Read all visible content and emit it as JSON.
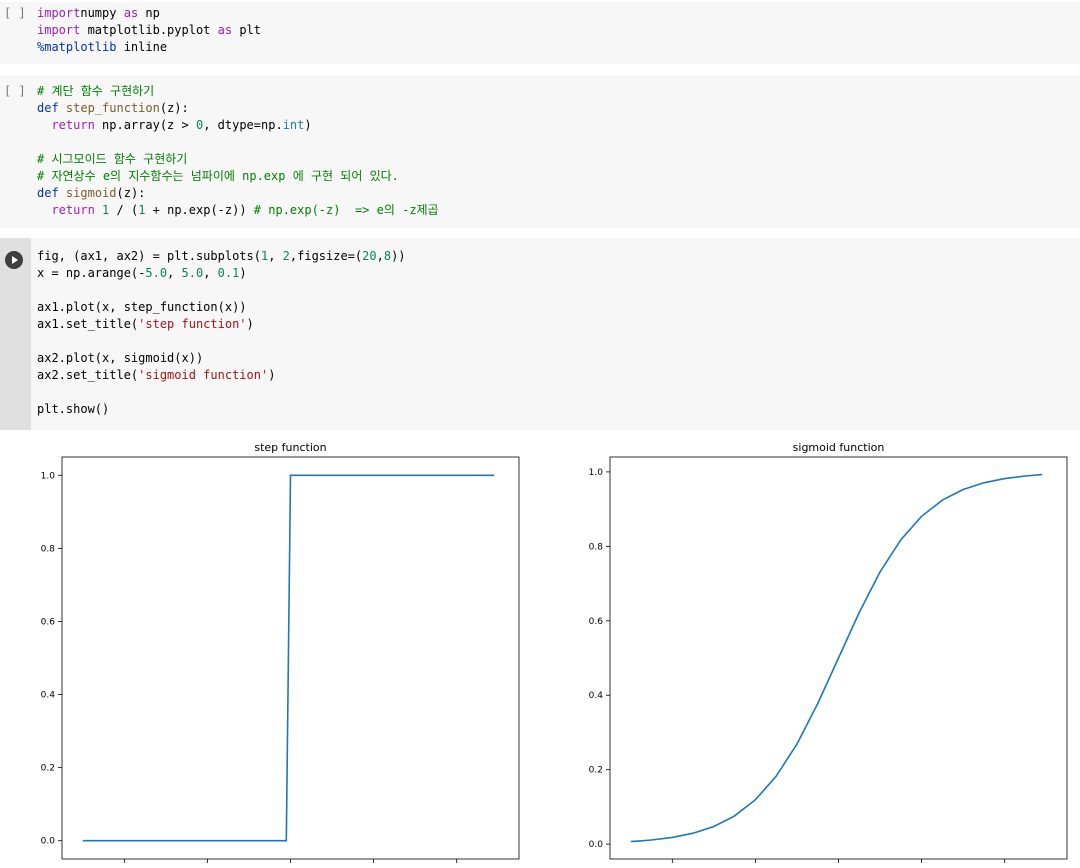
{
  "cells": [
    {
      "exec_count": "[ ]",
      "lines": [
        [
          [
            "kw",
            "import"
          ],
          [
            "",
            "numpy "
          ],
          [
            "kw",
            "as"
          ],
          [
            "",
            " np"
          ]
        ],
        [
          [
            "kw",
            "import"
          ],
          [
            "",
            " matplotlib.pyplot "
          ],
          [
            "kw",
            "as"
          ],
          [
            "",
            " plt"
          ]
        ],
        [
          [
            "mg",
            "%matplotlib"
          ],
          [
            "",
            " inline"
          ]
        ]
      ]
    },
    {
      "exec_count": "[ ]",
      "lines": [
        [
          [
            "cm",
            "# 계단 함수 구현하기"
          ]
        ],
        [
          [
            "kw2",
            "def"
          ],
          [
            "",
            " "
          ],
          [
            "fn",
            "step_function"
          ],
          [
            "",
            "(z):"
          ]
        ],
        [
          [
            "",
            "  "
          ],
          [
            "kw",
            "return"
          ],
          [
            "",
            " np.array(z > "
          ],
          [
            "num",
            "0"
          ],
          [
            "",
            ", dtype=np."
          ],
          [
            "bi",
            "int"
          ],
          [
            "",
            ")"
          ]
        ],
        [
          [
            "",
            ""
          ]
        ],
        [
          [
            "cm",
            "# 시그모이드 함수 구현하기"
          ]
        ],
        [
          [
            "cm",
            "# 자연상수 e의 지수함수는 넘파이에 np.exp 에 구현 되어 있다."
          ]
        ],
        [
          [
            "kw2",
            "def"
          ],
          [
            "",
            " "
          ],
          [
            "fn",
            "sigmoid"
          ],
          [
            "",
            "(z):"
          ]
        ],
        [
          [
            "",
            "  "
          ],
          [
            "kw",
            "return"
          ],
          [
            "",
            " "
          ],
          [
            "num",
            "1"
          ],
          [
            "",
            " / ("
          ],
          [
            "num",
            "1"
          ],
          [
            "",
            " + np.exp(-z)) "
          ],
          [
            "cm",
            "# np.exp(-z)  => e의 -z제곱"
          ]
        ]
      ]
    },
    {
      "exec_count": "",
      "lines": [
        [
          [
            "",
            "fig, (ax1, ax2) = plt.subplots("
          ],
          [
            "num",
            "1"
          ],
          [
            "",
            ", "
          ],
          [
            "num",
            "2"
          ],
          [
            "",
            ",figsize=("
          ],
          [
            "num",
            "20"
          ],
          [
            "",
            ","
          ],
          [
            "num",
            "8"
          ],
          [
            "",
            "))"
          ]
        ],
        [
          [
            "",
            "x = np.arange(-"
          ],
          [
            "num",
            "5.0"
          ],
          [
            "",
            ", "
          ],
          [
            "num",
            "5.0"
          ],
          [
            "",
            ", "
          ],
          [
            "num",
            "0.1"
          ],
          [
            "",
            ")"
          ]
        ],
        [
          [
            "",
            ""
          ]
        ],
        [
          [
            "",
            "ax1.plot(x, step_function(x))"
          ]
        ],
        [
          [
            "",
            "ax1.set_title("
          ],
          [
            "str",
            "'step function'"
          ],
          [
            "",
            ")"
          ]
        ],
        [
          [
            "",
            ""
          ]
        ],
        [
          [
            "",
            "ax2.plot(x, sigmoid(x))"
          ]
        ],
        [
          [
            "",
            "ax2.set_title("
          ],
          [
            "str",
            "'sigmoid function'"
          ],
          [
            "",
            ")"
          ]
        ],
        [
          [
            "",
            ""
          ]
        ],
        [
          [
            "",
            "plt.show()"
          ]
        ]
      ]
    }
  ],
  "chart_data": [
    {
      "type": "line",
      "title": "step function",
      "xlabel": "",
      "ylabel": "",
      "xlim": [
        -5.5,
        5.5
      ],
      "ylim": [
        -0.05,
        1.05
      ],
      "yticks": [
        0.0,
        0.2,
        0.4,
        0.6,
        0.8,
        1.0
      ],
      "ytick_labels": [
        "0.0",
        "0.2",
        "0.4",
        "0.6",
        "0.8",
        "1.0"
      ],
      "xticks": [
        -4,
        -2,
        0,
        2,
        4
      ],
      "x": [
        -5.0,
        -0.1,
        0.0,
        4.9
      ],
      "y": [
        0,
        0,
        1,
        1
      ],
      "color": "#1f77b4",
      "grid": false
    },
    {
      "type": "line",
      "title": "sigmoid function",
      "xlabel": "",
      "ylabel": "",
      "xlim": [
        -5.5,
        5.5
      ],
      "ylim": [
        -0.04,
        1.04
      ],
      "yticks": [
        0.0,
        0.2,
        0.4,
        0.6,
        0.8,
        1.0
      ],
      "ytick_labels": [
        "0.0",
        "0.2",
        "0.4",
        "0.6",
        "0.8",
        "1.0"
      ],
      "xticks": [
        -4,
        -2,
        0,
        2,
        4
      ],
      "x": [
        -5.0,
        -4.5,
        -4.0,
        -3.5,
        -3.0,
        -2.5,
        -2.0,
        -1.5,
        -1.0,
        -0.5,
        0.0,
        0.5,
        1.0,
        1.5,
        2.0,
        2.5,
        3.0,
        3.5,
        4.0,
        4.5,
        4.9
      ],
      "y": [
        0.0067,
        0.011,
        0.018,
        0.0293,
        0.0474,
        0.0759,
        0.1192,
        0.1824,
        0.2689,
        0.3775,
        0.5,
        0.6225,
        0.7311,
        0.8176,
        0.8808,
        0.9241,
        0.9526,
        0.9707,
        0.982,
        0.989,
        0.9926
      ],
      "color": "#1f77b4",
      "grid": false
    }
  ]
}
